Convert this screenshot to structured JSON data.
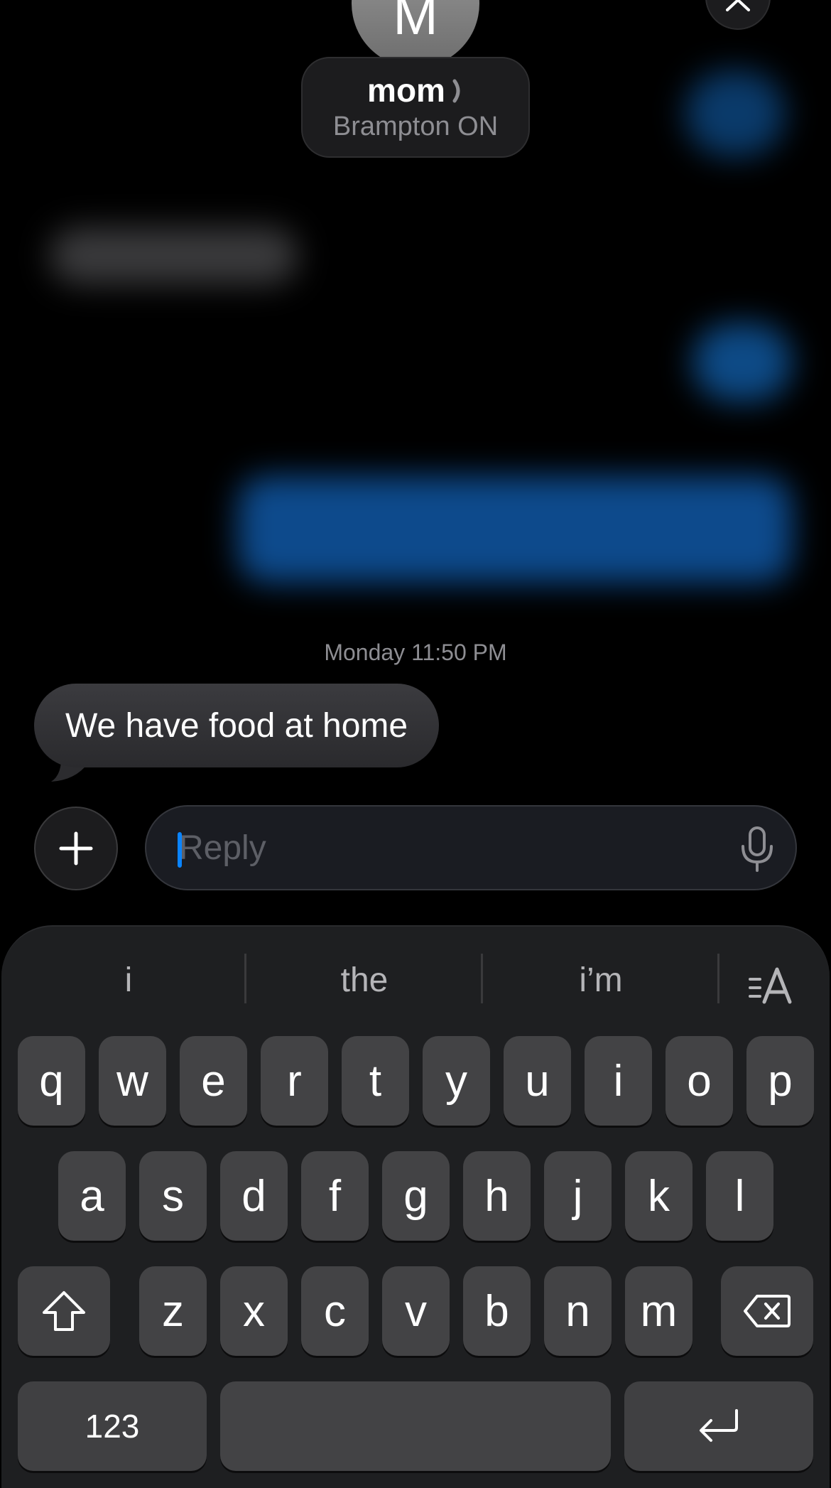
{
  "header": {
    "avatar_initial": "M",
    "contact_name": "mom",
    "contact_location": "Brampton ON",
    "chevron_icon": "chevron-right-icon",
    "close_icon": "close-icon"
  },
  "conversation": {
    "timestamp": "Monday 11:50 PM",
    "messages": [
      {
        "direction": "received",
        "text": "We have food at home"
      }
    ]
  },
  "compose": {
    "add_icon": "plus-icon",
    "placeholder": "Reply",
    "value": "",
    "mic_icon": "microphone-icon"
  },
  "keyboard": {
    "suggestions": [
      "i",
      "the",
      "i’m"
    ],
    "text_format_icon": "text-format-icon",
    "rows": [
      [
        "q",
        "w",
        "e",
        "r",
        "t",
        "y",
        "u",
        "i",
        "o",
        "p"
      ],
      [
        "a",
        "s",
        "d",
        "f",
        "g",
        "h",
        "j",
        "k",
        "l"
      ],
      [
        "z",
        "x",
        "c",
        "v",
        "b",
        "n",
        "m"
      ]
    ],
    "shift_icon": "shift-icon",
    "delete_icon": "delete-icon",
    "numbers_label": "123",
    "return_icon": "return-icon"
  },
  "colors": {
    "accent": "#0a84ff",
    "background": "#000000",
    "received_bubble": "#3a3a3c",
    "sent_bubble": "#0d4a8c"
  }
}
